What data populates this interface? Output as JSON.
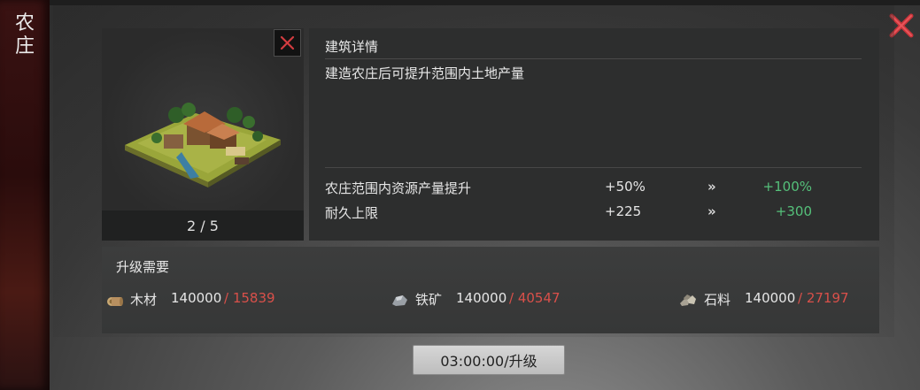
{
  "side_title": "农\n庄",
  "building": {
    "level_text": "2 / 5"
  },
  "info": {
    "title": "建筑详情",
    "description": "建造农庄后可提升范围内土地产量",
    "stats": [
      {
        "label": "农庄范围内资源产量提升",
        "current": "+50%",
        "arrow": "»",
        "next": "+100%"
      },
      {
        "label": "耐久上限",
        "current": "+225",
        "arrow": "»",
        "next": "+300"
      }
    ]
  },
  "requirements": {
    "title": "升级需要",
    "resources": [
      {
        "icon": "wood-icon",
        "name": "木材",
        "amount": "140000",
        "have": " / 15839"
      },
      {
        "icon": "iron-ore-icon",
        "name": "铁矿",
        "amount": "140000",
        "have": " / 40547"
      },
      {
        "icon": "stone-icon",
        "name": "石料",
        "amount": "140000",
        "have": " / 27197"
      }
    ]
  },
  "upgrade_button": "03:00:00/升级",
  "colors": {
    "next_value": "#55c07a",
    "insufficient": "#d9504a",
    "close_red": "#c8343a"
  }
}
